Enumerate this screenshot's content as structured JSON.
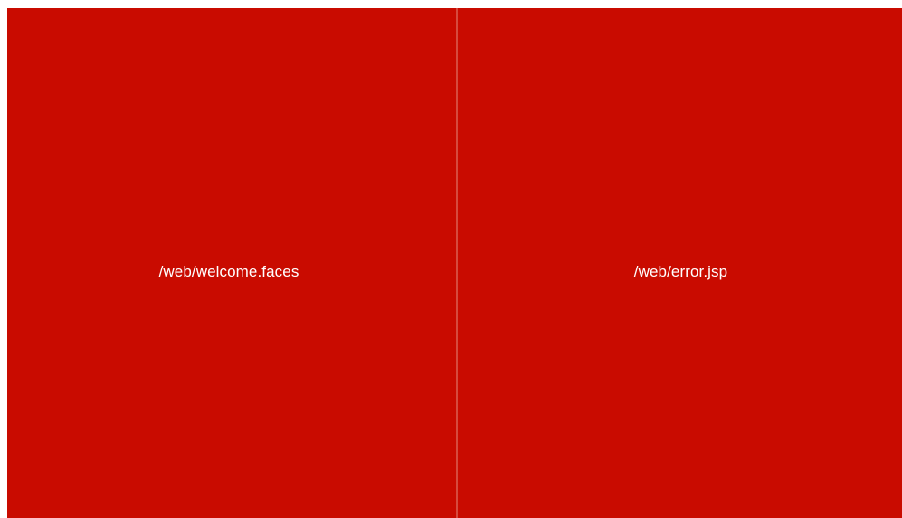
{
  "panels": [
    {
      "label": "/web/welcome.faces"
    },
    {
      "label": "/web/error.jsp"
    }
  ],
  "colors": {
    "panel_background": "#c90b00",
    "divider": "#d64a3e",
    "label_text": "#ffffff"
  }
}
